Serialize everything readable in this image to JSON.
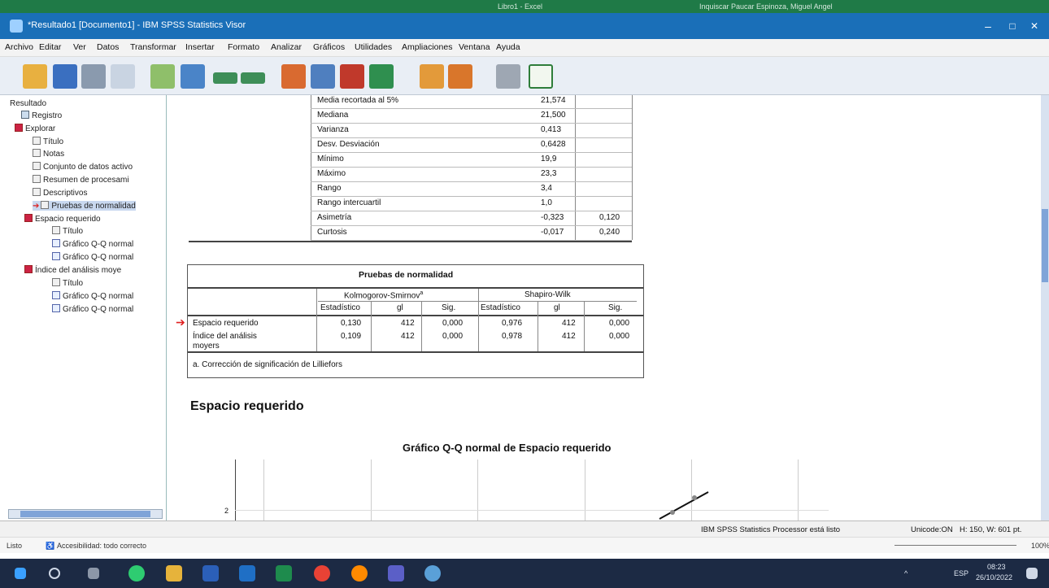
{
  "top_strip": {
    "center": "Libro1 - Excel",
    "user": "Inquiscar Paucar Espinoza, Miguel Angel"
  },
  "window": {
    "title": "*Resultado1 [Documento1] - IBM SPSS Statistics Visor",
    "min": "–",
    "max": "□",
    "close": "✕"
  },
  "menu": [
    "Archivo",
    "Editar",
    "Ver",
    "Datos",
    "Transformar",
    "Insertar",
    "Formato",
    "Analizar",
    "Gráficos",
    "Utilidades",
    "Ampliaciones",
    "Ventana",
    "Ayuda"
  ],
  "nav": {
    "items": [
      "Resultado",
      "Registro",
      "Explorar",
      "Título",
      "Notas",
      "Conjunto de datos activo",
      "Resumen de procesami",
      "Descriptivos",
      "Pruebas de normalidad",
      "Espacio requerido",
      "Título",
      "Gráfico Q-Q normal",
      "Gráfico Q-Q normal",
      "Índice del análisis moye",
      "Título",
      "Gráfico Q-Q normal",
      "Gráfico Q-Q normal"
    ]
  },
  "descriptives": {
    "rows": [
      {
        "label": "Media recortada al 5%",
        "stat": "21,574",
        "err": ""
      },
      {
        "label": "Mediana",
        "stat": "21,500",
        "err": ""
      },
      {
        "label": "Varianza",
        "stat": "0,413",
        "err": ""
      },
      {
        "label": "Desv. Desviación",
        "stat": "0,6428",
        "err": ""
      },
      {
        "label": "Mínimo",
        "stat": "19,9",
        "err": ""
      },
      {
        "label": "Máximo",
        "stat": "23,3",
        "err": ""
      },
      {
        "label": "Rango",
        "stat": "3,4",
        "err": ""
      },
      {
        "label": "Rango intercuartil",
        "stat": "1,0",
        "err": ""
      },
      {
        "label": "Asimetría",
        "stat": "-0,323",
        "err": "0,120"
      },
      {
        "label": "Curtosis",
        "stat": "-0,017",
        "err": "0,240"
      }
    ]
  },
  "normality": {
    "title": "Pruebas de normalidad",
    "group_ks": "Kolmogorov-Smirnov",
    "group_ks_sup": "a",
    "group_sw": "Shapiro-Wilk",
    "cols": [
      "Estadístico",
      "gl",
      "Sig.",
      "Estadístico",
      "gl",
      "Sig."
    ],
    "rows": [
      {
        "label": "Espacio requerido",
        "label2": "",
        "vals": [
          "0,130",
          "412",
          "0,000",
          "0,976",
          "412",
          "0,000"
        ]
      },
      {
        "label": "Índice del análisis",
        "label2": "moyers",
        "vals": [
          "0,109",
          "412",
          "0,000",
          "0,978",
          "412",
          "0,000"
        ]
      }
    ],
    "footnote": "a. Corrección de significación de Lilliefors"
  },
  "section_heading": "Espacio requerido",
  "chart_title": "Gráfico Q-Q normal de Espacio requerido",
  "chart_ytick": "2",
  "status": {
    "processor": "IBM SPSS Statistics Processor está listo",
    "unicode": "Unicode:ON",
    "dims": "H: 150, W: 601 pt."
  },
  "status2": {
    "listo": "Listo",
    "access": "Accesibilidad: todo correcto",
    "zoom": "100%"
  },
  "taskbar": {
    "lang": "ESP",
    "time": "08:23",
    "date": "26/10/2022"
  }
}
